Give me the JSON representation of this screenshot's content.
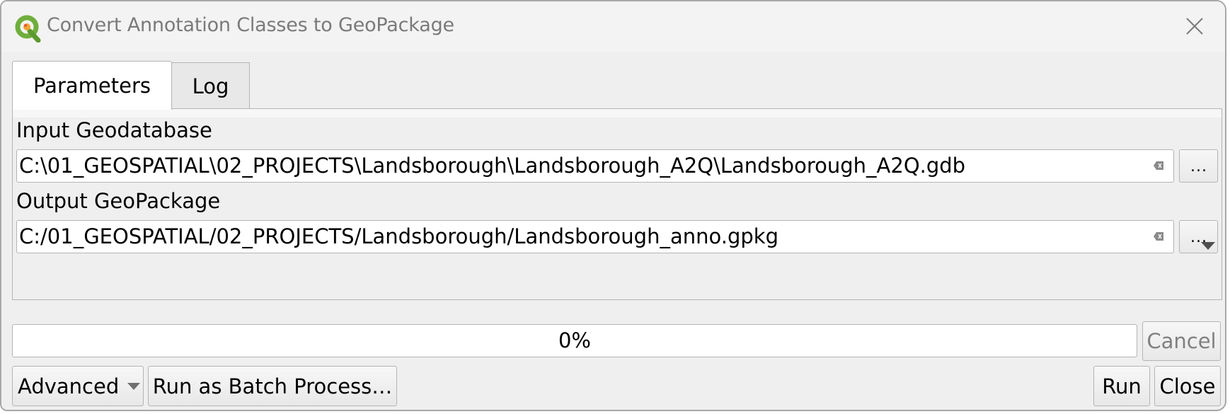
{
  "window": {
    "title": "Convert Annotation Classes to GeoPackage",
    "app_icon": "qgis-logo-icon",
    "close_icon": "close-icon"
  },
  "tabs": [
    {
      "label": "Parameters",
      "active": true
    },
    {
      "label": "Log",
      "active": false
    }
  ],
  "parameters": {
    "input_geodatabase": {
      "label": "Input Geodatabase",
      "value": "C:\\01_GEOSPATIAL\\02_PROJECTS\\Landsborough\\Landsborough_A2Q\\Landsborough_A2Q.gdb",
      "browse_label": "..."
    },
    "output_geopackage": {
      "label": "Output GeoPackage",
      "value": "C:/01_GEOSPATIAL/02_PROJECTS/Landsborough/Landsborough_anno.gpkg",
      "browse_label": "..."
    }
  },
  "progress": {
    "value_percent": 0,
    "text": "0%"
  },
  "buttons": {
    "cancel": "Cancel",
    "advanced": "Advanced",
    "batch": "Run as Batch Process…",
    "run": "Run",
    "close": "Close"
  },
  "colors": {
    "qgis_green": "#6fae3c",
    "qgis_orange": "#f0a330"
  }
}
